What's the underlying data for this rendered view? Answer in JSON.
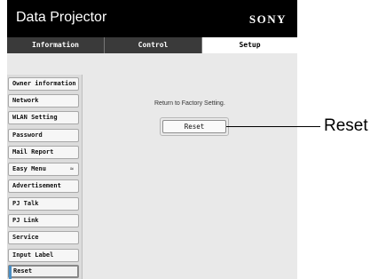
{
  "header": {
    "title": "Data Projector",
    "brand": "SONY"
  },
  "tabs": [
    {
      "label": "Information"
    },
    {
      "label": "Control"
    },
    {
      "label": "Setup"
    }
  ],
  "sidebar": {
    "items": [
      {
        "label": "Owner information"
      },
      {
        "label": "Network"
      },
      {
        "label": "WLAN Setting"
      },
      {
        "label": "Password"
      },
      {
        "label": "Mail Report"
      },
      {
        "label": "Easy Menu",
        "chevron": "≈"
      },
      {
        "label": "Advertisement"
      },
      {
        "label": "PJ Talk"
      },
      {
        "label": "PJ Link"
      },
      {
        "label": "Service"
      },
      {
        "label": "Input Label"
      },
      {
        "label": "Reset"
      }
    ]
  },
  "main": {
    "message": "Return to Factory Setting.",
    "reset_button": "Reset"
  },
  "callout": {
    "label": "Reset"
  }
}
